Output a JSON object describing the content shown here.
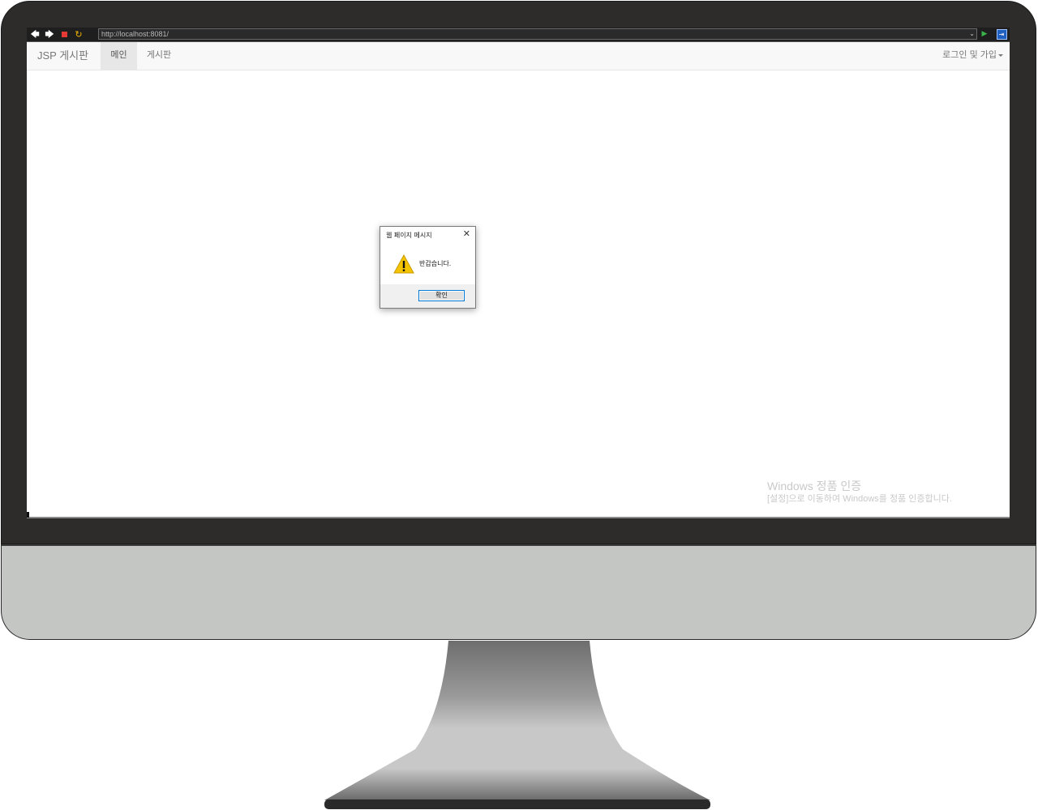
{
  "browser": {
    "url": "http://localhost:8081/"
  },
  "navbar": {
    "brand": "JSP 게시판",
    "items": [
      {
        "label": "메인",
        "active": true
      },
      {
        "label": "게시판",
        "active": false
      }
    ],
    "right_menu": "로그인 및 가입"
  },
  "dialog": {
    "title": "웹 페이지 메시지",
    "message": "반갑습니다.",
    "ok_label": "확인",
    "close_symbol": "✕"
  },
  "watermark": {
    "title": "Windows 정품 인증",
    "subtitle": "[설정]으로 이동하여 Windows를 정품 인증합니다."
  },
  "colors": {
    "bezel": "#2d2c2a",
    "chin": "#c4c6c4",
    "accent": "#0078d7",
    "warning": "#f5c400"
  }
}
